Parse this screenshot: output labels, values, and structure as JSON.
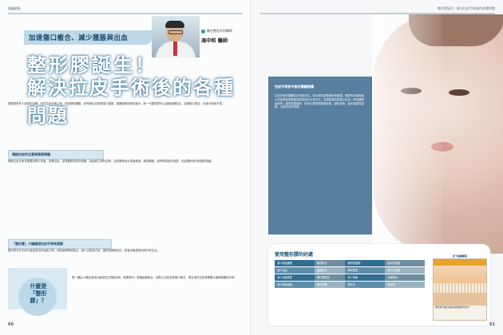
{
  "left_page": {
    "section_label": "美麗觀點",
    "subtitle": "加速傷口癒合、減少腫脹與出血",
    "title_line1": "整形膠誕生！",
    "title_line2": "解決拉皮手術後的各種問題",
    "doctor": {
      "hospital": "聯合整形外科醫師",
      "name": "馮中和 醫師"
    },
    "intro": "美觀是許多人追求的目標，但在拉皮手術之後，恢復期的腫脹、瘀青與出血常常讓人困擾。隨著醫學技術的進步，新一代整形膠可以協助組織貼合，加速傷口癒合，也減少術後不適。",
    "box1": "傳統拉皮的注意與復原問題",
    "paragraph1": "傳統拉皮手術常需要放置引流管、加壓包紮，並需要較長的恢復期。若組織之間有空隙，容易累積血水或組織液，增加腫脹、瘀青與感染的風險，也影響術後外觀與舒適度。",
    "box2": "「整形膠」大幅縮短拉皮手術恢復期",
    "paragraph2": "整形膠可在手術中直接塗布於組織之間，幫助組織緊密黏合，減少空腔與滲液，讓恢復期更穩定，患者也能更快回到日常生活。",
    "what_label_line1": "什麼是",
    "what_label_line2": "「整形膠」？",
    "what_text": "是一種由人體血液成分製成的生物黏合劑，能像膠水一樣讓組織貼合，協助止血並促進傷口癒合，適合用於拉皮等需要大面積剝離的手術。",
    "page_number": "60"
  },
  "right_page": {
    "section_label": "整形膠誕生！解決拉皮手術後的各種問題",
    "panel_title": "拉皮手術前中後的關鍵照護",
    "panel_text": "拉皮手術的關鍵在於術前評估、術中精準處理與術後照護。醫師會依照每個人的皮膚鬆弛程度與臉型設計手術方式，並搭配整形膠減少出血、降低腫脹與瘀青，讓恢復更順利。術後仍需遵照醫囑保養，避免熬夜、抽菸與劇烈運動，以維持良好效果。",
    "card_title": "使用整形膠的好處",
    "table": [
      [
        "減少術後腫脹",
        "降低瘀青",
        "縮短恢復期",
        "提高舒適度"
      ],
      [
        "減少出血",
        "組織貼合",
        "降低感染",
        "減少引流管"
      ],
      [
        "減少血腫風險",
        "傷口更穩定",
        "減少縫線",
        "加速癒合"
      ],
      [
        "減少術後疤痕",
        "提升效果",
        "更安全",
        "更自然"
      ]
    ],
    "diagram_title": "皮下組織構造",
    "diagram_caption": "整形膠可讓皮膚與深層組織緊密貼合",
    "page_number": "61"
  }
}
